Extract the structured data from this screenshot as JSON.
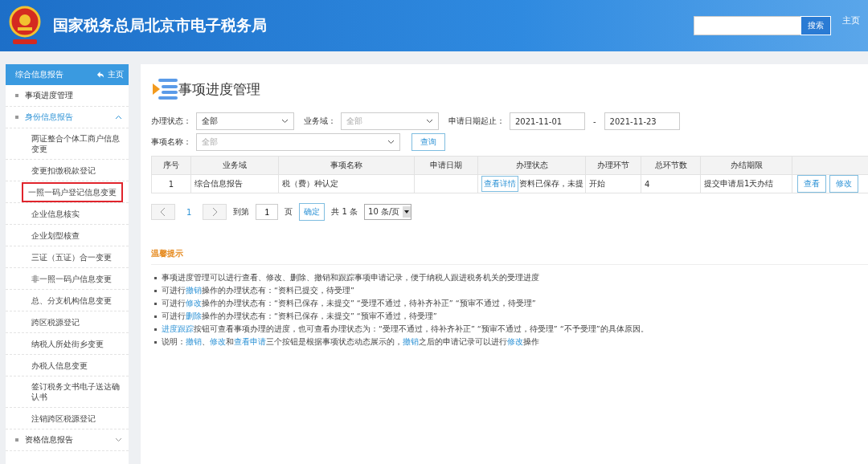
{
  "header": {
    "title": "国家税务总局北京市电子税务局",
    "search_button": "搜索",
    "home_link": "主页"
  },
  "sidebar": {
    "title": "综合信息报告",
    "home_link": "主页",
    "items": [
      {
        "label": "事项进度管理",
        "selected": false
      },
      {
        "label": "身份信息报告",
        "selected": true,
        "expanded": true,
        "children": [
          {
            "label": "两证整合个体工商户信息变更",
            "highlighted": false
          },
          {
            "label": "变更扣缴税款登记",
            "highlighted": false
          },
          {
            "label": "一照一码户登记信息变更",
            "highlighted": true
          },
          {
            "label": "企业信息核实",
            "highlighted": false
          },
          {
            "label": "企业划型核查",
            "highlighted": false
          },
          {
            "label": "三证（五证）合一变更",
            "highlighted": false
          },
          {
            "label": "非一照一码户信息变更",
            "highlighted": false
          },
          {
            "label": "总、分支机构信息变更",
            "highlighted": false
          },
          {
            "label": "跨区税源登记",
            "highlighted": false
          },
          {
            "label": "纳税人所处街乡变更",
            "highlighted": false
          },
          {
            "label": "办税人信息变更",
            "highlighted": false
          },
          {
            "label": "签订税务文书电子送达确认书",
            "highlighted": false
          },
          {
            "label": "注销跨区税源登记",
            "highlighted": false
          }
        ]
      },
      {
        "label": "资格信息报告",
        "selected": false,
        "expanded": false
      }
    ]
  },
  "page_title": "事项进度管理",
  "filters": [
    {
      "kind": "select",
      "label": "办理状态：",
      "value": "全部"
    },
    {
      "kind": "select",
      "label": "业务域：",
      "placeholder": "全部"
    },
    {
      "kind": "daterange",
      "label": "申请日期起止：",
      "from": "2021-11-01",
      "separator": "-",
      "to": "2021-11-23"
    },
    {
      "kind": "select",
      "label": "事项名称：",
      "placeholder": "全部",
      "wide": true
    },
    {
      "kind": "button",
      "label": "查询"
    }
  ],
  "table": {
    "columns": [
      "序号",
      "业务域",
      "事项名称",
      "申请日期",
      "办理状态",
      "办理环节",
      "总环节数",
      "办结期限",
      ""
    ],
    "rows": [
      {
        "cells": [
          "1",
          "综合信息报告",
          "税（费）种认定",
          "",
          "资料已保存，未提",
          "开始",
          "4",
          "提交申请后1天办结"
        ],
        "detail_button": "查看详情",
        "actions": [
          "查看",
          "修改"
        ]
      }
    ]
  },
  "pagination": {
    "pages": [
      {
        "label": "1",
        "selected": true
      }
    ],
    "goto_label": "到第",
    "page_value": "1",
    "page_unit": "页",
    "confirm": "确定",
    "total": "共 1 条",
    "page_size": "10 条/页"
  },
  "tips": {
    "title": "温馨提示",
    "items": [
      [
        {
          "text": "事项进度管理可以进行查看、修改、删除、撤销和跟踪事项申请记录，便于纳税人跟进税务机关的受理进度"
        }
      ],
      [
        {
          "text": "可进行"
        },
        {
          "text": "撤销",
          "link": true
        },
        {
          "text": "操作的办理状态有：“资料已提交，待受理”"
        }
      ],
      [
        {
          "text": "可进行"
        },
        {
          "text": "修改",
          "link": true
        },
        {
          "text": "操作的办理状态有：“资料已保存，未提交”  “受理不通过，待补齐补正”  “预审不通过，待受理”"
        }
      ],
      [
        {
          "text": "可进行"
        },
        {
          "text": "删除",
          "link": true
        },
        {
          "text": "操作的办理状态有：“资料已保存，未提交”  “预审不通过，待受理”"
        }
      ],
      [
        {
          "text": "进度跟踪",
          "link": true
        },
        {
          "text": "按钮可查看事项办理的进度，也可查看办理状态为：“受理不通过，待补齐补正”  “预审不通过，待受理”  “不予受理”的具体原因。"
        }
      ],
      [
        {
          "text": "说明："
        },
        {
          "text": "撤销",
          "link": true
        },
        {
          "text": "、"
        },
        {
          "text": "修改",
          "link": true
        },
        {
          "text": "和"
        },
        {
          "text": "查看申请",
          "link": true
        },
        {
          "text": "三个按钮是根据事项状态动态展示的，"
        },
        {
          "text": "撤销",
          "link": true
        },
        {
          "text": "之后的申请记录可以进行"
        },
        {
          "text": "修改",
          "link": true
        },
        {
          "text": "操作"
        }
      ]
    ]
  }
}
